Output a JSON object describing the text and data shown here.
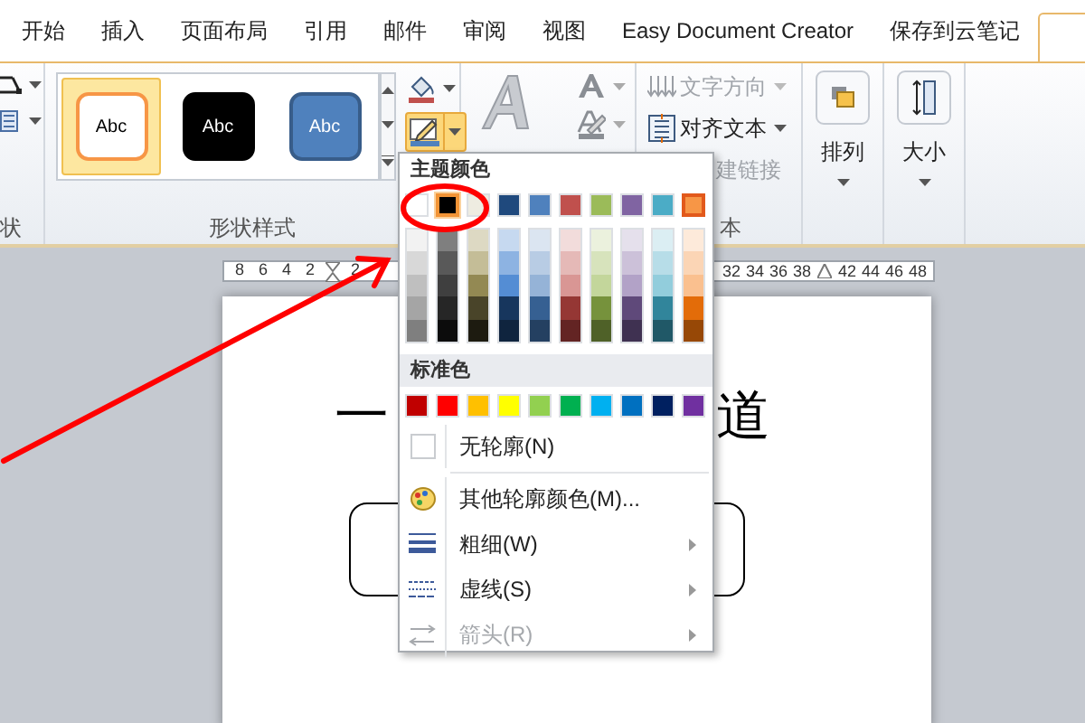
{
  "tabs": [
    {
      "kind": "text",
      "label": "开始",
      "selected": false
    },
    {
      "kind": "text",
      "label": "插入",
      "selected": false
    },
    {
      "kind": "text",
      "label": "页面布局",
      "selected": false
    },
    {
      "kind": "text",
      "label": "引用",
      "selected": false
    },
    {
      "kind": "text",
      "label": "邮件",
      "selected": false
    },
    {
      "kind": "text",
      "label": "审阅",
      "selected": false
    },
    {
      "kind": "text",
      "label": "视图",
      "selected": false
    },
    {
      "kind": "text",
      "label": "Easy Document Creator",
      "selected": false
    },
    {
      "kind": "text",
      "label": "保存到云笔记",
      "selected": false
    },
    {
      "kind": "clipped",
      "selected": true
    }
  ],
  "ribbon": {
    "groups": [
      {
        "kind": "clipped",
        "label": "状"
      },
      {
        "kind": "shape_styles",
        "label": "形状样式",
        "gallery": [
          {
            "kind": "outlined",
            "text": "Abc",
            "selected": true
          },
          {
            "kind": "dark",
            "text": "Abc",
            "selected": false
          },
          {
            "kind": "blue",
            "text": "Abc",
            "selected": false
          }
        ],
        "outline_pressed": true
      },
      {
        "kind": "wordart"
      },
      {
        "kind": "text",
        "label": "本",
        "items": [
          {
            "kind": "direction",
            "label": "文字方向",
            "disabled": true
          },
          {
            "kind": "align",
            "label": "对齐文本",
            "disabled": false
          },
          {
            "kind": "clipped",
            "label": "建链接",
            "disabled": true
          }
        ]
      },
      {
        "kind": "large",
        "label": "排列"
      },
      {
        "kind": "large",
        "label": "大小"
      }
    ]
  },
  "ruler": {
    "left_labels": [
      "8",
      "6",
      "4",
      "2",
      "2"
    ],
    "right_labels": [
      "32",
      "34",
      "36",
      "38",
      "42",
      "44",
      "46",
      "48"
    ]
  },
  "document": {
    "heading_fragments": [
      "一",
      "道"
    ]
  },
  "outline_menu": {
    "theme_header": "主题颜色",
    "theme_colors": [
      {
        "color": "#ffffff",
        "selected": false,
        "hovered": false,
        "shades": [
          {
            "color": "#f2f2f2"
          },
          {
            "color": "#d8d8d8"
          },
          {
            "color": "#bfbfbf"
          },
          {
            "color": "#a5a5a5"
          },
          {
            "color": "#7f7f7f"
          }
        ]
      },
      {
        "color": "#000000",
        "selected": true,
        "hovered": false,
        "shades": [
          {
            "color": "#7f7f7f"
          },
          {
            "color": "#595959"
          },
          {
            "color": "#3f3f3f"
          },
          {
            "color": "#262626"
          },
          {
            "color": "#0c0c0c"
          }
        ]
      },
      {
        "color": "#eeece1",
        "selected": false,
        "hovered": false,
        "shades": [
          {
            "color": "#ddd9c3"
          },
          {
            "color": "#c4bd97"
          },
          {
            "color": "#938953"
          },
          {
            "color": "#494429"
          },
          {
            "color": "#1d1b10"
          }
        ]
      },
      {
        "color": "#1f497d",
        "selected": false,
        "hovered": false,
        "shades": [
          {
            "color": "#c6d9f0"
          },
          {
            "color": "#8db3e2"
          },
          {
            "color": "#548dd4"
          },
          {
            "color": "#17365d"
          },
          {
            "color": "#0f243e"
          }
        ]
      },
      {
        "color": "#4f81bd",
        "selected": false,
        "hovered": false,
        "shades": [
          {
            "color": "#dbe5f1"
          },
          {
            "color": "#b8cce4"
          },
          {
            "color": "#95b3d7"
          },
          {
            "color": "#366092"
          },
          {
            "color": "#244061"
          }
        ]
      },
      {
        "color": "#c0504d",
        "selected": false,
        "hovered": false,
        "shades": [
          {
            "color": "#f2dcdb"
          },
          {
            "color": "#e5b9b7"
          },
          {
            "color": "#d99694"
          },
          {
            "color": "#953734"
          },
          {
            "color": "#632423"
          }
        ]
      },
      {
        "color": "#9bbb59",
        "selected": false,
        "hovered": false,
        "shades": [
          {
            "color": "#ebf1dd"
          },
          {
            "color": "#d7e3bc"
          },
          {
            "color": "#c3d69b"
          },
          {
            "color": "#76923c"
          },
          {
            "color": "#4f6128"
          }
        ]
      },
      {
        "color": "#8064a2",
        "selected": false,
        "hovered": false,
        "shades": [
          {
            "color": "#e5e0ec"
          },
          {
            "color": "#ccc1d9"
          },
          {
            "color": "#b2a2c7"
          },
          {
            "color": "#5f497a"
          },
          {
            "color": "#3f3151"
          }
        ]
      },
      {
        "color": "#4bacc6",
        "selected": false,
        "hovered": false,
        "shades": [
          {
            "color": "#dbeef3"
          },
          {
            "color": "#b7dde8"
          },
          {
            "color": "#92cddc"
          },
          {
            "color": "#31859b"
          },
          {
            "color": "#205867"
          }
        ]
      },
      {
        "color": "#f79646",
        "selected": false,
        "hovered": true,
        "shades": [
          {
            "color": "#fdeada"
          },
          {
            "color": "#fbd5b5"
          },
          {
            "color": "#fac08f"
          },
          {
            "color": "#e36c09"
          },
          {
            "color": "#974806"
          }
        ]
      }
    ],
    "standard_header": "标准色",
    "standard_colors": [
      {
        "color": "#c00000"
      },
      {
        "color": "#ff0000"
      },
      {
        "color": "#ffc000"
      },
      {
        "color": "#ffff00"
      },
      {
        "color": "#92d050"
      },
      {
        "color": "#00b050"
      },
      {
        "color": "#00b0f0"
      },
      {
        "color": "#0070c0"
      },
      {
        "color": "#002060"
      },
      {
        "color": "#7030a0"
      }
    ],
    "items": [
      {
        "kind": "no_outline",
        "label": "无轮廓(N)",
        "submenu": false,
        "disabled": false
      },
      {
        "kind": "more_colors",
        "label": "其他轮廓颜色(M)...",
        "submenu": false,
        "disabled": false
      },
      {
        "kind": "weight",
        "label": "粗细(W)",
        "submenu": true,
        "disabled": false
      },
      {
        "kind": "dashes",
        "label": "虚线(S)",
        "submenu": true,
        "disabled": false
      },
      {
        "kind": "arrows",
        "label": "箭头(R)",
        "submenu": true,
        "disabled": true
      }
    ]
  }
}
